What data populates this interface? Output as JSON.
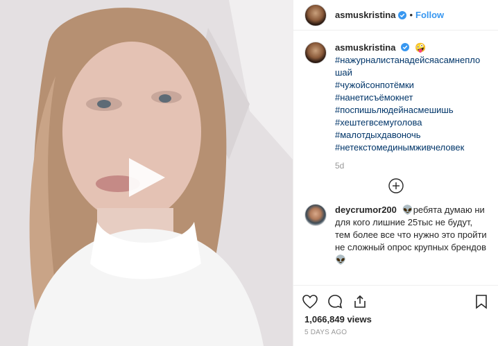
{
  "header": {
    "username": "asmuskristina",
    "separator": "•",
    "follow_label": "Follow"
  },
  "caption": {
    "username": "asmuskristina",
    "emoji": "🤪",
    "hashtags": [
      "#нажурналистанадейсяасамнепло шай",
      "#чужойсонпотёмки",
      "#нанетисъёмокнет",
      "#поспишьлюдейнасмешишь",
      "#хештегвсемуголова",
      "#малотдыхдавоночь",
      "#нетекстомединымживчеловек"
    ],
    "time": "5d"
  },
  "comment": {
    "username": "deycrumor200",
    "emoji_start": "👽",
    "text": "ребята думаю ни для кого лишние 25тыс не будут, тем более все что нужно это пройти не сложный опрос крупных брендов",
    "emoji_end": "👽"
  },
  "actions": {
    "icons": [
      "heart-icon",
      "comment-icon",
      "share-icon",
      "bookmark-icon"
    ]
  },
  "stats": {
    "views": "1,066,849 views",
    "date": "5 DAYS AGO"
  },
  "colors": {
    "link": "#3897f0",
    "hashtag": "#003569",
    "verified": "#3897f0"
  }
}
